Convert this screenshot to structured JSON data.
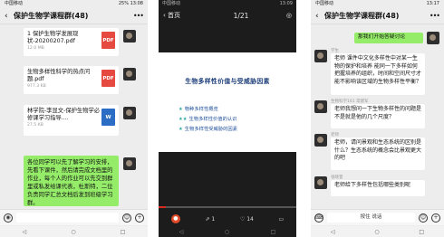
{
  "phone1": {
    "status_left": "中国移动",
    "status_right": "25% 13:08",
    "title": "保护生物学课程群(48)",
    "files": [
      {
        "name": "1 保护生物学发展现状-20200207.pdf",
        "size": "12.0 MB",
        "type": "PDF"
      },
      {
        "name": "生物多样性科学的热点问题.pdf",
        "size": "977.3 KB",
        "type": "PDF"
      },
      {
        "name": "林学院-李显文-保护生物学必修课学习指导....",
        "size": "27.5 KB",
        "type": "W"
      }
    ],
    "message": "各位同学可以先了解学习的安排，先看下课件，然后请完成文档里的作业，每个人的作业可以先交到群里或私发给课代表，杜斯特，二位负责同学汇总文档后发到班级学习群。",
    "nav": [
      "◁",
      "○",
      "□"
    ]
  },
  "phone2": {
    "status_left": "中国移动",
    "status_right": "13:09",
    "back_label": "首页",
    "page_indicator": "1/21",
    "slide_title": "生物多样性价值与受威胁因素",
    "bullets": [
      "物种多样性概览",
      "生物多样性价值的认识",
      "生物多样性受威胁的因素"
    ],
    "progress_percent": 5,
    "controls": {
      "forward": "1",
      "likes": "14"
    },
    "nav": [
      "◁",
      "○",
      "□"
    ]
  },
  "phone3": {
    "status_left": "中国移动",
    "status_right": "13:17",
    "title": "保护生物学课程群(48)",
    "green_message": "那我们开始答疑讨论",
    "messages": [
      {
        "sender": "学生",
        "text": "老师 课件中文化多样性中对某一生物的保护和培养 能同一下多样如何把握培养的组织，时间和空间尺寸才能不影响该区域的生物多样性平衡？"
      },
      {
        "sender": "生物科学161 常建军",
        "text": "老师我想问一下生物多样性的问题是不是就是他的几个尺度？"
      },
      {
        "sender": "老师",
        "text": "老师，请问景观和生态系统的区别是什么？生态系统的概念会比景观更大的吧"
      },
      {
        "sender": "张晓萱",
        "text": "老师给下多样性包括哪些类别呢"
      }
    ],
    "input_label": "按住 说话",
    "nav": [
      "◁",
      "○",
      "□"
    ]
  }
}
